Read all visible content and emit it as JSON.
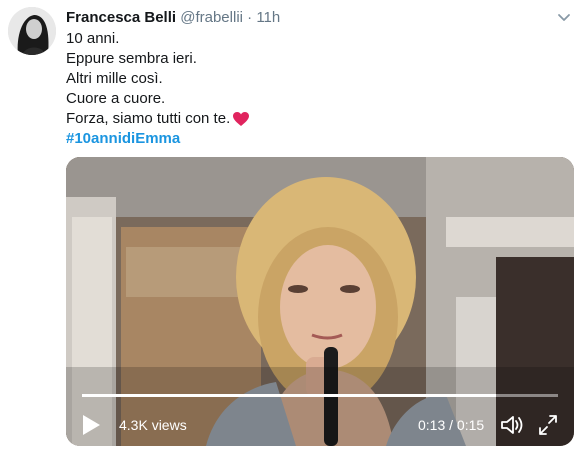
{
  "tweet": {
    "author_name": "Francesca Belli",
    "handle": "@frabellii",
    "separator": "·",
    "time": "11h",
    "lines": [
      "10 anni.",
      "Eppure sembra ieri.",
      "Altri mille così.",
      "Cuore a cuore.",
      "Forza, siamo tutti con te."
    ],
    "hashtag": "#10annidiEmma",
    "heart_icon": "red-heart-icon"
  },
  "video": {
    "views": "4.3K views",
    "timecode": "0:13 / 0:15",
    "progress": 0.87
  },
  "colors": {
    "link": "#1b95e0",
    "secondary_text": "#657786",
    "heart": "#e0245e"
  }
}
